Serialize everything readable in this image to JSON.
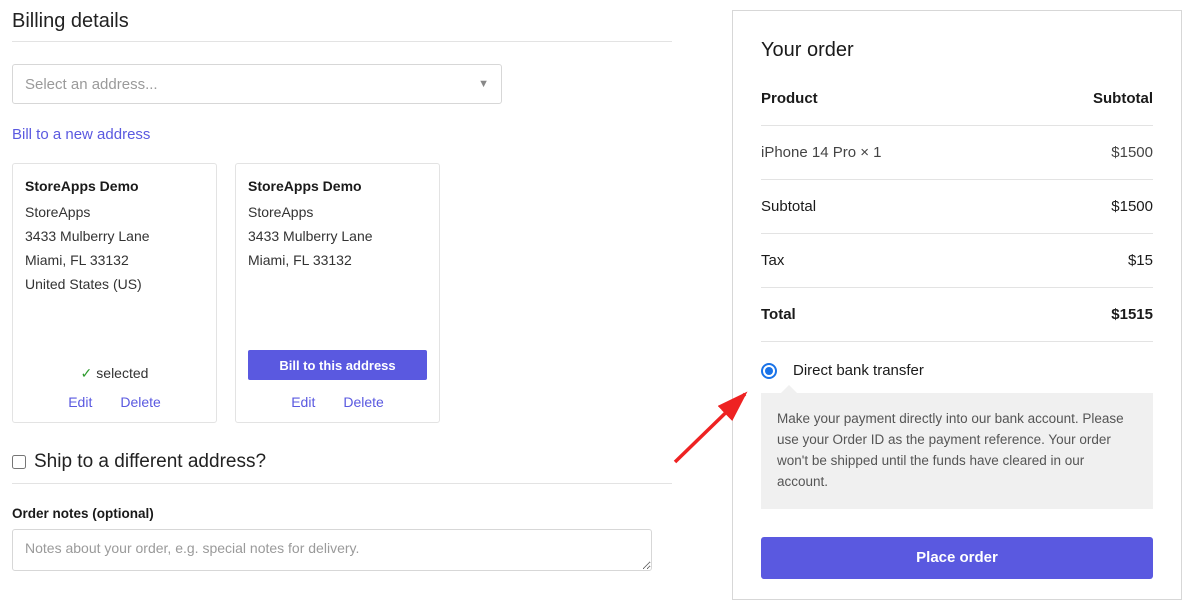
{
  "billing": {
    "title": "Billing details",
    "select_placeholder": "Select an address...",
    "new_address_link": "Bill to a new address",
    "cards": [
      {
        "name": "StoreApps Demo",
        "company": "StoreApps",
        "street": "3433 Mulberry Lane",
        "city_line": "Miami, FL 33132",
        "country": "United States (US)",
        "selected_label": "selected",
        "edit": "Edit",
        "delete": "Delete"
      },
      {
        "name": "StoreApps Demo",
        "company": "StoreApps",
        "street": "3433 Mulberry Lane",
        "city_line": "Miami, FL 33132",
        "bill_btn": "Bill to this address",
        "edit": "Edit",
        "delete": "Delete"
      }
    ],
    "ship_diff_label": "Ship to a different address?",
    "notes_label": "Order notes (optional)",
    "notes_placeholder": "Notes about your order, e.g. special notes for delivery."
  },
  "order": {
    "title": "Your order",
    "head_product": "Product",
    "head_subtotal": "Subtotal",
    "item_name": "iPhone 14 Pro  × 1",
    "item_price": "$1500",
    "subtotal_label": "Subtotal",
    "subtotal_value": "$1500",
    "tax_label": "Tax",
    "tax_value": "$15",
    "total_label": "Total",
    "total_value": "$1515",
    "payment_method": "Direct bank transfer",
    "payment_desc": "Make your payment directly into our bank account. Please use your Order ID as the payment reference. Your order won't be shipped until the funds have cleared in our account.",
    "place_order": "Place order"
  }
}
